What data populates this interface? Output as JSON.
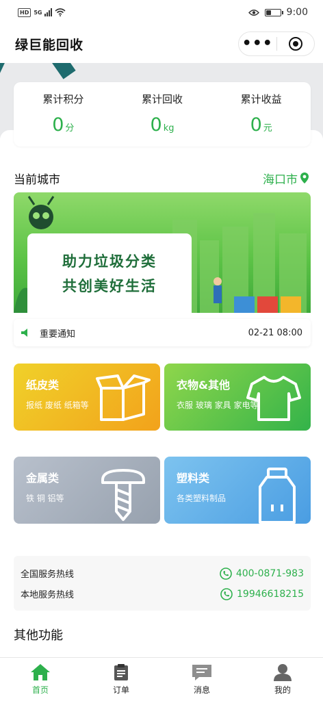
{
  "status_bar": {
    "network": "5G",
    "hd": "HD",
    "time": "9:00",
    "battery_level": 0.35
  },
  "header": {
    "title": "绿巨能回收"
  },
  "stats": [
    {
      "label": "累计积分",
      "value": "0",
      "unit": "分"
    },
    {
      "label": "累计回收",
      "value": "0",
      "unit": "kg"
    },
    {
      "label": "累计收益",
      "value": "0",
      "unit": "元"
    }
  ],
  "city": {
    "label": "当前城市",
    "value": "海口市"
  },
  "banner": {
    "line1": "助力垃圾分类",
    "line2": "共创美好生活"
  },
  "notice": {
    "label": "重要通知",
    "time": "02-21 08:00"
  },
  "categories": [
    {
      "title": "纸皮类",
      "desc": "报纸 废纸 纸箱等",
      "icon": "box-icon"
    },
    {
      "title": "衣物&其他",
      "desc": "衣服 玻璃 家具 家电等",
      "icon": "shirt-icon"
    },
    {
      "title": "金属类",
      "desc": "铁 铜 铝等",
      "icon": "screw-icon"
    },
    {
      "title": "塑料类",
      "desc": "各类塑料制品",
      "icon": "bottle-icon"
    }
  ],
  "hotlines": [
    {
      "label": "全国服务热线",
      "number": "400-0871-983"
    },
    {
      "label": "本地服务热线",
      "number": "19946618215"
    }
  ],
  "other_section": {
    "title": "其他功能"
  },
  "tabbar": [
    {
      "label": "首页",
      "icon": "home-icon",
      "active": true
    },
    {
      "label": "订单",
      "icon": "clipboard-icon",
      "active": false
    },
    {
      "label": "消息",
      "icon": "message-icon",
      "active": false
    },
    {
      "label": "我的",
      "icon": "user-icon",
      "active": false
    }
  ],
  "colors": {
    "accent": "#2db04c",
    "paper": "#f2a21b",
    "cloth": "#33b34a",
    "metal": "#97a1ae",
    "plastic": "#4a9de2"
  }
}
